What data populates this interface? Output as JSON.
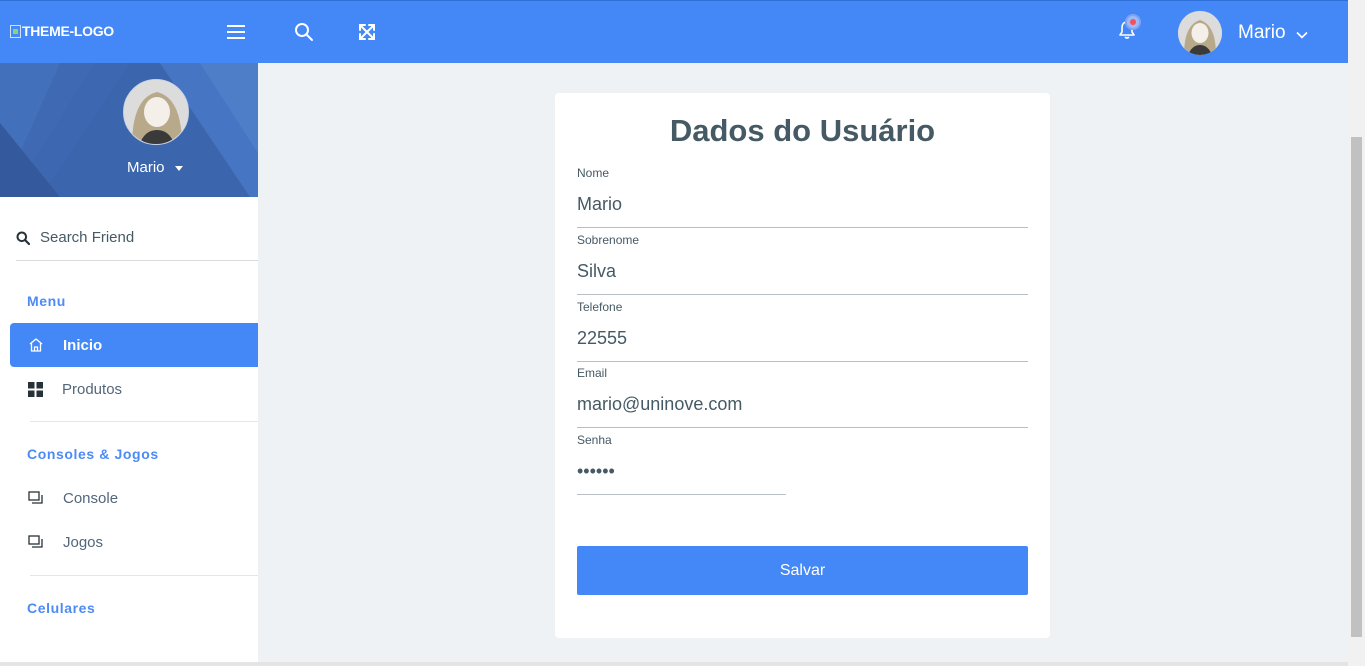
{
  "topbar": {
    "logo_alt": "THEME-LOGO",
    "user_name": "Mario",
    "icons": [
      "hamburger-icon",
      "search-icon",
      "expand-icon",
      "bell-icon",
      "chevron-down-icon"
    ]
  },
  "sidebar": {
    "profile_name": "Mario",
    "search_placeholder": "Search Friend",
    "sections": [
      {
        "title": "Menu",
        "items": [
          {
            "label": "Inicio",
            "icon": "home-icon",
            "active": true
          },
          {
            "label": "Produtos",
            "icon": "grid-icon",
            "active": false
          }
        ]
      },
      {
        "title": "Consoles & Jogos",
        "items": [
          {
            "label": "Console",
            "icon": "windows-icon",
            "active": false
          },
          {
            "label": "Jogos",
            "icon": "windows-icon",
            "active": false
          }
        ]
      },
      {
        "title": "Celulares",
        "items": []
      }
    ]
  },
  "form": {
    "title": "Dados do Usuário",
    "fields": [
      {
        "label": "Nome",
        "value": "Mario"
      },
      {
        "label": "Sobrenome",
        "value": "Silva"
      },
      {
        "label": "Telefone",
        "value": "22555"
      },
      {
        "label": "Email",
        "value": "mario@uninove.com"
      },
      {
        "label": "Senha",
        "value": "••••••"
      }
    ],
    "submit_label": "Salvar"
  },
  "colors": {
    "primary": "#4488f8",
    "banner": "#3b65ad",
    "background": "#eef2f5",
    "section_title": "#4c8bf5",
    "notification": "#f1525b"
  }
}
